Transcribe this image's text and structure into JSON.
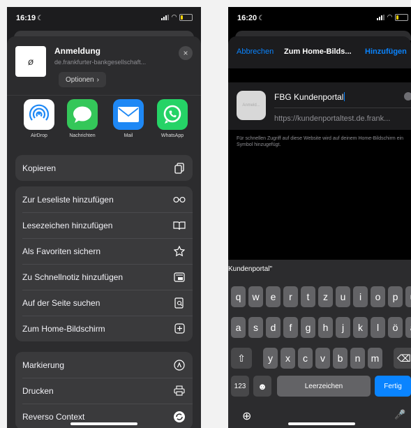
{
  "left": {
    "status": {
      "time": "16:19",
      "moon": "☾"
    },
    "header": {
      "title": "Anmeldung",
      "url": "de.frankfurter-bankgesellschaft...",
      "options_label": "Optionen",
      "options_chevron": "›",
      "thumb_glyph": "ø",
      "close_glyph": "×"
    },
    "apps": [
      {
        "label": "AirDrop",
        "color": "#ffffff",
        "icon": "airdrop-icon"
      },
      {
        "label": "Nachrichten",
        "color": "#34c759",
        "icon": "messages-icon"
      },
      {
        "label": "Mail",
        "color": "#1e88f5",
        "icon": "mail-icon"
      },
      {
        "label": "WhatsApp",
        "color": "#25d366",
        "icon": "whatsapp-icon"
      }
    ],
    "group1": [
      {
        "label": "Kopieren",
        "icon": "copy-icon"
      }
    ],
    "group2": [
      {
        "label": "Zur Leseliste hinzufügen",
        "icon": "glasses-icon"
      },
      {
        "label": "Lesezeichen hinzufügen",
        "icon": "book-icon"
      },
      {
        "label": "Als Favoriten sichern",
        "icon": "star-icon"
      },
      {
        "label": "Zu Schnellnotiz hinzufügen",
        "icon": "quicknote-icon"
      },
      {
        "label": "Auf der Seite suchen",
        "icon": "find-icon"
      },
      {
        "label": "Zum Home-Bildschirm",
        "icon": "add-square-icon"
      }
    ],
    "group3": [
      {
        "label": "Markierung",
        "icon": "markup-icon"
      },
      {
        "label": "Drucken",
        "icon": "print-icon"
      },
      {
        "label": "Reverso Context",
        "icon": "reverso-icon"
      }
    ]
  },
  "right": {
    "status": {
      "time": "16:20",
      "moon": "☾"
    },
    "nav": {
      "cancel": "Abbrechen",
      "title": "Zum Home-Bilds...",
      "add": "Hinzufügen"
    },
    "card": {
      "icon_text": "Anmeld...",
      "title_value": "FBG Kundenportal",
      "url": "https://kundenportaltest.de.frank..."
    },
    "hint": "Für schnellen Zugriff auf diese Website wird auf deinem Home-Bildschirm ein Symbol hinzugefügt.",
    "keyboard": {
      "suggestion": "Kundenportal\"",
      "row1": [
        "q",
        "w",
        "e",
        "r",
        "t",
        "z",
        "u",
        "i",
        "o",
        "p",
        "ü"
      ],
      "row2": [
        "a",
        "s",
        "d",
        "f",
        "g",
        "h",
        "j",
        "k",
        "l",
        "ö",
        "ä"
      ],
      "row3": [
        "y",
        "x",
        "c",
        "v",
        "b",
        "n",
        "m"
      ],
      "shift": "⇧",
      "delete": "⌫",
      "numbers": "123",
      "emoji": "☻",
      "space": "Leerzeichen",
      "done": "Fertig",
      "globe": "⊕",
      "mic": "🎤"
    }
  },
  "colors": {
    "accent": "#0a84ff",
    "sheet": "#2c2c2e",
    "row": "#3a3a3c"
  }
}
